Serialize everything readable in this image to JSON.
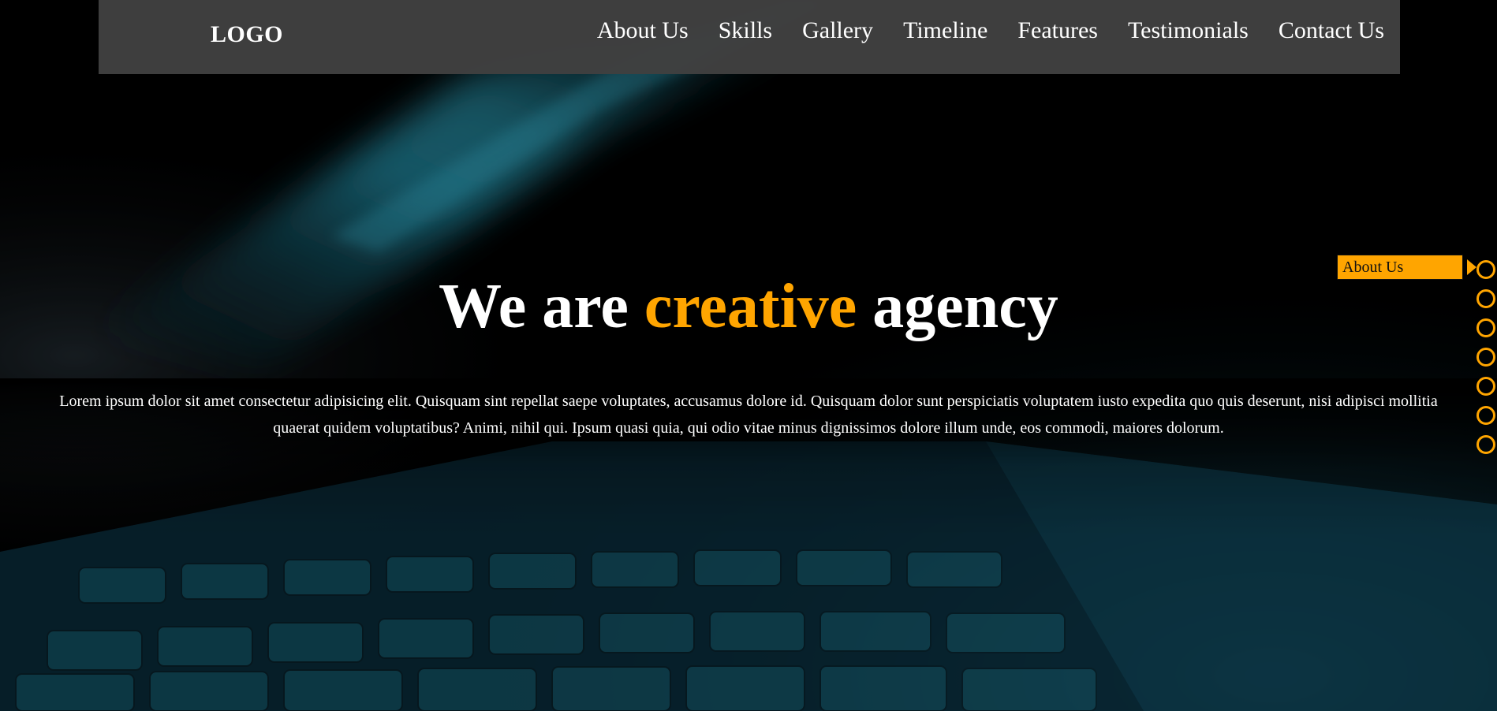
{
  "header": {
    "logo": "LOGO",
    "nav": [
      {
        "label": "About Us"
      },
      {
        "label": "Skills"
      },
      {
        "label": "Gallery"
      },
      {
        "label": "Timeline"
      },
      {
        "label": "Features"
      },
      {
        "label": "Testimonials"
      },
      {
        "label": "Contact Us"
      }
    ]
  },
  "hero": {
    "title_part1": "We are",
    "title_accent": "creative",
    "title_part2": "agency",
    "text": "Lorem ipsum dolor sit amet consectetur adipisicing elit. Quisquam sint repellat saepe voluptates, accusamus dolore id. Quisquam dolor sunt perspiciatis voluptatem iusto expedita quo quis deserunt, nisi adipisci mollitia quaerat quidem voluptatibus? Animi, nihil qui. Ipsum quasi quia, qui odio vitae minus dignissimos dolore illum unde, eos commodi, maiores dolorum."
  },
  "side_nav": {
    "active_tooltip": "About Us",
    "bullet_count": 7
  },
  "colors": {
    "accent": "#ffa500",
    "nav_background": "#404040",
    "background": "#000000"
  },
  "background_image": {
    "subject": "laptop-keyboard-photo"
  }
}
